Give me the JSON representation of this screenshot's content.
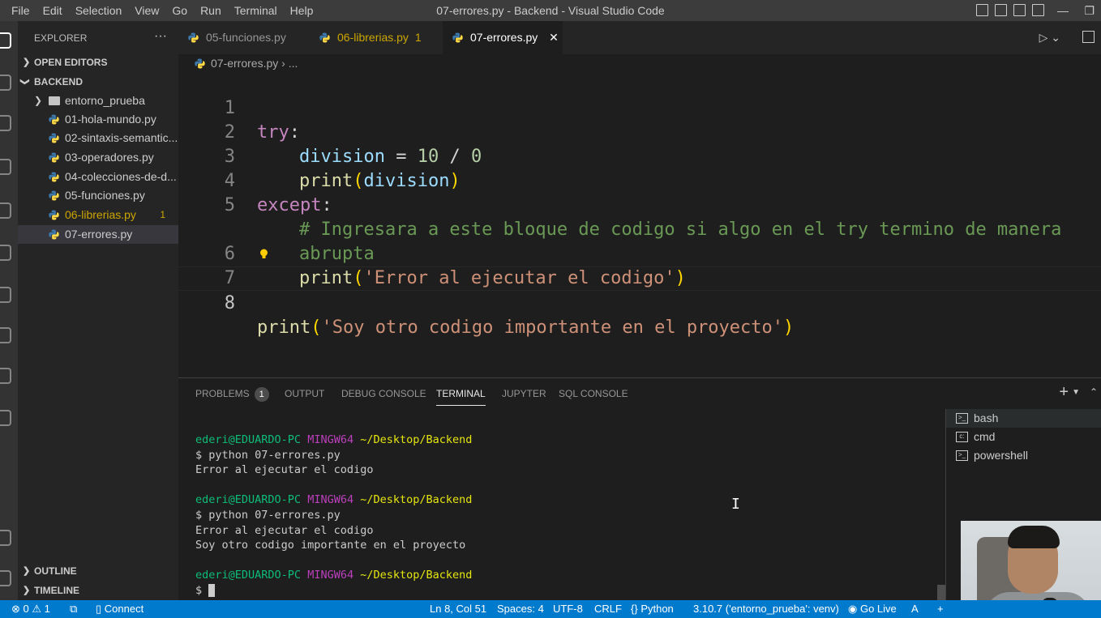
{
  "menubar": [
    "File",
    "Edit",
    "Selection",
    "View",
    "Go",
    "Run",
    "Terminal",
    "Help"
  ],
  "window_title": "07-errores.py - Backend - Visual Studio Code",
  "window_controls": {
    "minimize": "—",
    "restore": "❐"
  },
  "sidebar": {
    "header": "EXPLORER",
    "more": "···",
    "open_editors": "OPEN EDITORS",
    "folder": "BACKEND",
    "items": [
      {
        "label": "entorno_prueba",
        "type": "folder"
      },
      {
        "label": "01-hola-mundo.py",
        "type": "file"
      },
      {
        "label": "02-sintaxis-semantic...",
        "type": "file"
      },
      {
        "label": "03-operadores.py",
        "type": "file"
      },
      {
        "label": "04-colecciones-de-d...",
        "type": "file"
      },
      {
        "label": "05-funciones.py",
        "type": "file"
      },
      {
        "label": "06-librerias.py",
        "type": "file",
        "badge": "1"
      },
      {
        "label": "07-errores.py",
        "type": "file"
      }
    ],
    "outline": "OUTLINE",
    "timeline": "TIMELINE"
  },
  "tabs": [
    {
      "label": "05-funciones.py"
    },
    {
      "label": "06-librerias.py",
      "badge": "1"
    },
    {
      "label": "07-errores.py",
      "close": "✕"
    }
  ],
  "breadcrumb": {
    "file": "07-errores.py",
    "rest": "..."
  },
  "editor": {
    "line_numbers": [
      "1",
      "2",
      "3",
      "4",
      "5",
      "",
      "6",
      "7",
      "8"
    ],
    "t_try": "try",
    "t_colon1": ":",
    "t_division": "division",
    "t_assign": " = ",
    "t_ten": "10",
    "t_div": " / ",
    "t_zero": "0",
    "t_print": "print",
    "t_open": "(",
    "t_close": ")",
    "t_except": "except",
    "t_colon2": ":",
    "t_comment1": "# Ingresara a este bloque de codigo si algo en el try termino de manera",
    "t_comment2": "abrupta",
    "t_str_error": "'Error al ejecutar el codigo'",
    "t_str_soy": "'Soy otro codigo importante en el proyecto'"
  },
  "panel": {
    "tabs": [
      {
        "label": "PROBLEMS",
        "badge": "1"
      },
      {
        "label": "OUTPUT"
      },
      {
        "label": "DEBUG CONSOLE"
      },
      {
        "label": "TERMINAL"
      },
      {
        "label": "JUPYTER"
      },
      {
        "label": "SQL CONSOLE"
      }
    ],
    "plus": "+",
    "terminal": {
      "user": "ederi@EDUARDO-PC",
      "shell": "MINGW64",
      "path": "~/Desktop/Backend",
      "cmd": "$ python 07-errores.py",
      "out1": "Error al ejecutar el codigo",
      "out2": "Soy otro codigo importante en el proyecto",
      "prompt": "$ "
    },
    "shells": [
      "bash",
      "cmd",
      "powershell"
    ],
    "ibeam": "I"
  },
  "statusbar": {
    "errors": "0",
    "warnings": "1",
    "connect": "Connect",
    "position": "Ln 8, Col 51",
    "spaces": "Spaces: 4",
    "encoding": "UTF-8",
    "eol": "CRLF",
    "language": "Python",
    "interpreter": "3.10.7 ('entorno_prueba': venv)",
    "golive": "Go Live",
    "extra": "+"
  },
  "colors": {
    "statusbar": "#007acc",
    "keyword": "#c586c0",
    "variable": "#9cdcfe",
    "function": "#dcdcaa",
    "string": "#ce9178",
    "comment": "#6a9955",
    "warning": "#cca700"
  }
}
